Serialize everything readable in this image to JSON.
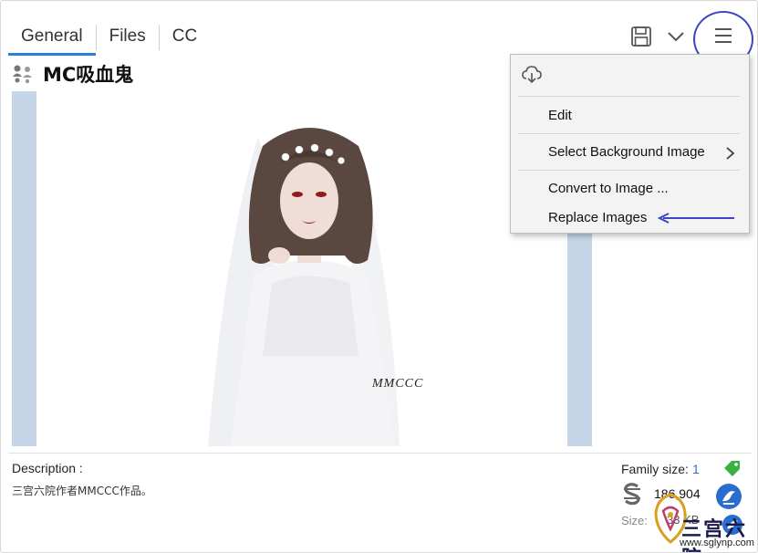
{
  "tabs": [
    {
      "label": "General",
      "active": true
    },
    {
      "label": "Files",
      "active": false
    },
    {
      "label": "CC",
      "active": false
    }
  ],
  "title": "MC吸血鬼",
  "preview": {
    "watermark": "MMCCC"
  },
  "menu": {
    "items": [
      {
        "label": "Edit"
      },
      {
        "label": "Select Background Image",
        "submenu": true
      },
      {
        "label": "Convert to Image ..."
      },
      {
        "label": "Replace Images"
      }
    ]
  },
  "description": {
    "label": "Description :",
    "text": "三宫六院作者MMCCC作品。"
  },
  "stats": {
    "family_label": "Family size:",
    "family_value": "1",
    "simoleons_value": "186,904",
    "size_label": "Size:",
    "size_value": "33 KB"
  },
  "site": {
    "name": "三宫六院",
    "url": "www.sglynp.com"
  },
  "icons": {
    "save": "save-icon",
    "dropdown": "chevron-down-icon",
    "menu": "hamburger-menu-icon",
    "cloud": "cloud-download-icon",
    "tag": "tag-icon",
    "simoleon": "simoleon-icon",
    "badge": "bird-badge-icon"
  },
  "colors": {
    "tab_underline": "#2b7fd8",
    "annotation": "#3a46c4",
    "family_value": "#2b6fc4",
    "tag": "#3cb043",
    "badge": "#2a6dd0"
  }
}
